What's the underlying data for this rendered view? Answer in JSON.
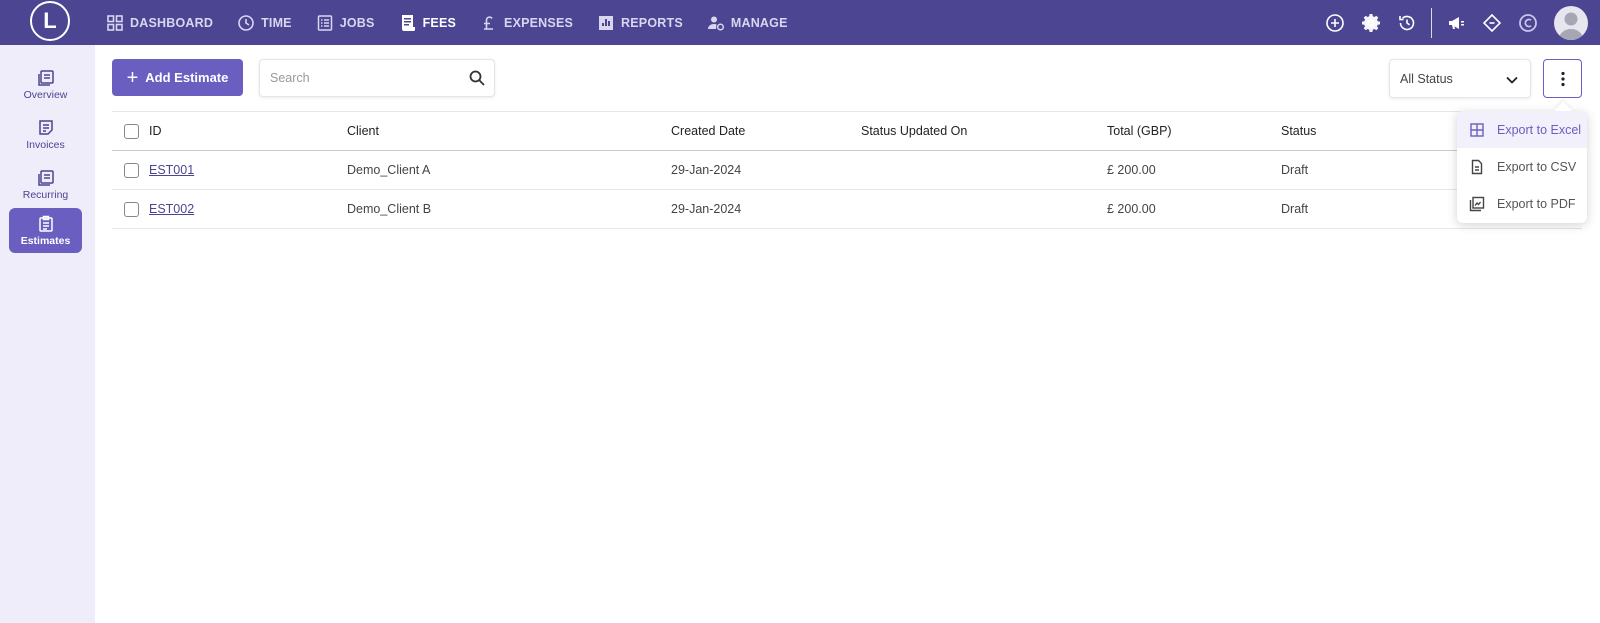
{
  "brand": {
    "logo_letter": "L"
  },
  "nav": {
    "items": [
      {
        "label": "DASHBOARD",
        "icon": "grid-icon",
        "active": false
      },
      {
        "label": "TIME",
        "icon": "clock-icon",
        "active": false
      },
      {
        "label": "JOBS",
        "icon": "list-icon",
        "active": false
      },
      {
        "label": "FEES",
        "icon": "receipt-icon",
        "active": true
      },
      {
        "label": "EXPENSES",
        "icon": "pound-icon",
        "active": false
      },
      {
        "label": "REPORTS",
        "icon": "bar-chart-icon",
        "active": false
      },
      {
        "label": "MANAGE",
        "icon": "user-gear-icon",
        "active": false
      }
    ]
  },
  "topbar_icons": [
    "plus-circle-icon",
    "gear-icon",
    "history-icon",
    "megaphone-icon",
    "ticket-icon",
    "currency-icon",
    "avatar-icon"
  ],
  "sidebar": {
    "items": [
      {
        "label": "Overview",
        "icon": "overview-icon",
        "active": false
      },
      {
        "label": "Invoices",
        "icon": "invoice-icon",
        "active": false
      },
      {
        "label": "Recurring",
        "icon": "recurring-icon",
        "active": false
      },
      {
        "label": "Estimates",
        "icon": "estimate-icon",
        "active": true
      }
    ]
  },
  "toolbar": {
    "add_label": "Add Estimate",
    "search_placeholder": "Search",
    "status_filter": "All Status"
  },
  "table": {
    "columns": [
      "ID",
      "Client",
      "Created Date",
      "Status Updated On",
      "Total (GBP)",
      "Status"
    ],
    "rows": [
      {
        "id": "EST001",
        "client": "Demo_Client A",
        "created": "29-Jan-2024",
        "updated": "",
        "total": "£ 200.00",
        "status": "Draft"
      },
      {
        "id": "EST002",
        "client": "Demo_Client B",
        "created": "29-Jan-2024",
        "updated": "",
        "total": "£ 200.00",
        "status": "Draft"
      }
    ]
  },
  "export_menu": {
    "items": [
      {
        "label": "Export to Excel",
        "icon": "excel-icon"
      },
      {
        "label": "Export to CSV",
        "icon": "csv-icon"
      },
      {
        "label": "Export to PDF",
        "icon": "pdf-icon"
      }
    ]
  },
  "colors": {
    "topbar": "#4b4592",
    "accent": "#6a5fc1",
    "sidebar_bg": "#efedfa"
  }
}
